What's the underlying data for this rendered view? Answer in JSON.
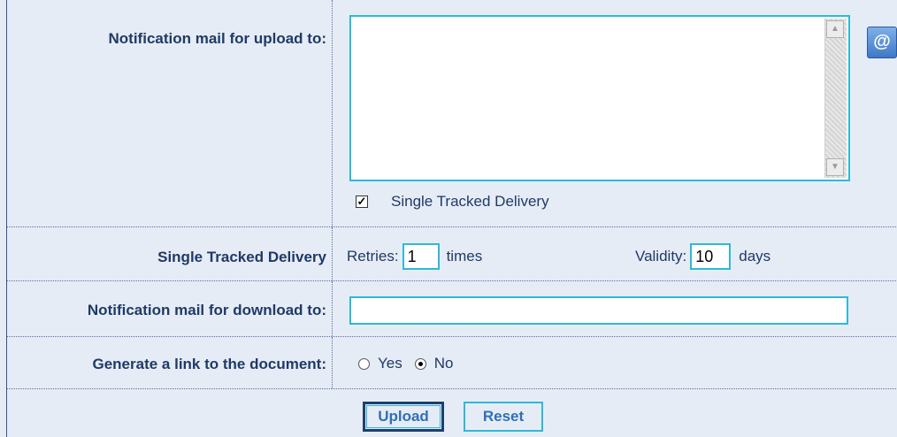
{
  "upload_row": {
    "label": "Notification mail for upload to:",
    "address_book_icon": "at-sign-address-book-icon",
    "textarea_value": "",
    "single_tracked_checkbox_checked": true,
    "single_tracked_checkbox_label": "Single Tracked Delivery"
  },
  "single_tracked_row": {
    "label": "Single Tracked Delivery",
    "retries_label": "Retries:",
    "retries_value": "1",
    "retries_unit": "times",
    "validity_label": "Validity:",
    "validity_value": "10",
    "validity_unit": "days"
  },
  "download_row": {
    "label": "Notification mail for download to:",
    "value": ""
  },
  "link_row": {
    "label": "Generate a link to the document:",
    "yes_label": "Yes",
    "no_label": "No",
    "selected": "No"
  },
  "buttons": {
    "upload": "Upload",
    "reset": "Reset"
  }
}
